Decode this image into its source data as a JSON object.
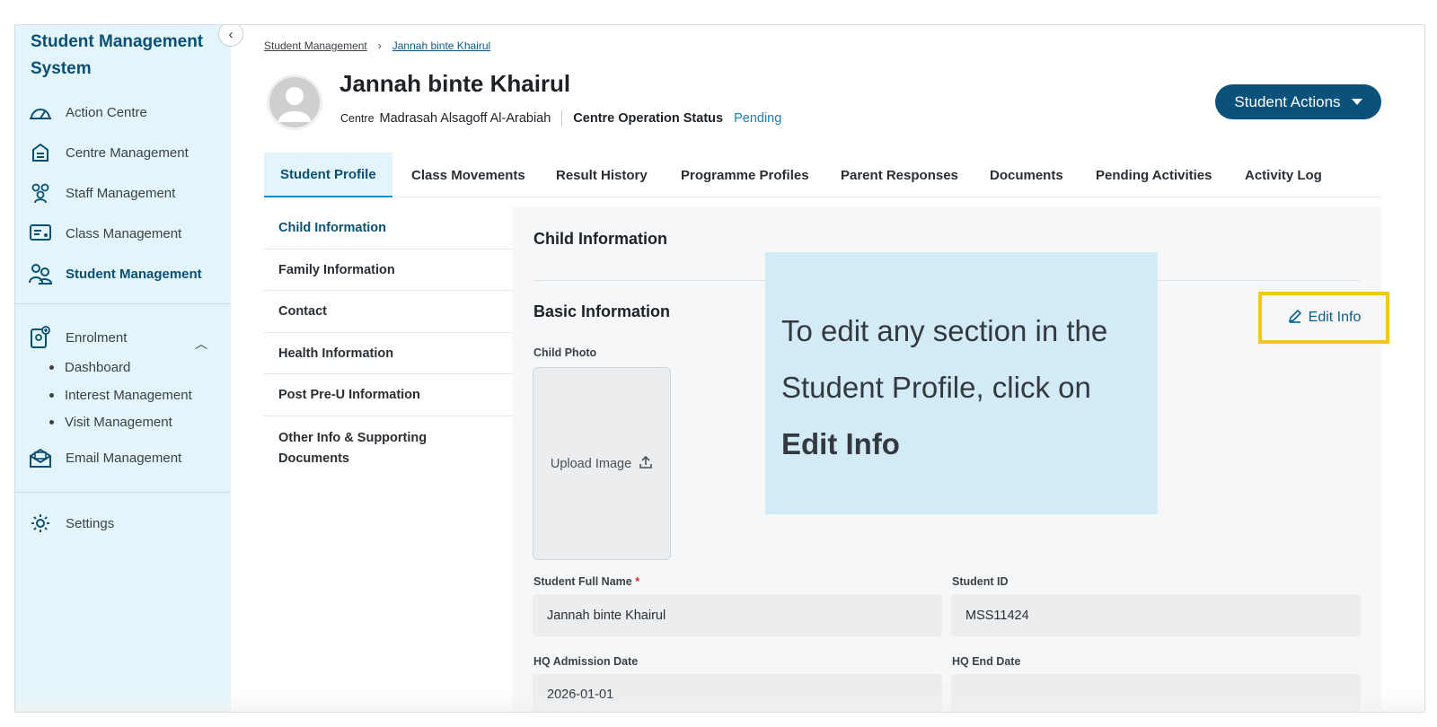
{
  "app": {
    "title": "Student Management System"
  },
  "sidebar": {
    "items": [
      {
        "label": "Action Centre",
        "icon": "dashboard-gauge-icon"
      },
      {
        "label": "Centre Management",
        "icon": "building-icon"
      },
      {
        "label": "Staff Management",
        "icon": "staff-group-icon"
      },
      {
        "label": "Class Management",
        "icon": "classroom-board-icon"
      },
      {
        "label": "Student Management",
        "icon": "students-icon",
        "active": true
      }
    ],
    "enrolment": {
      "label": "Enrolment",
      "icon": "enrolment-form-icon",
      "expanded": true,
      "children": [
        "Dashboard",
        "Interest Management",
        "Visit Management"
      ]
    },
    "email": {
      "label": "Email Management",
      "icon": "email-envelope-icon"
    },
    "settings": {
      "label": "Settings",
      "icon": "gear-icon"
    }
  },
  "breadcrumb": {
    "root": "Student Management",
    "current": "Jannah binte Khairul"
  },
  "student": {
    "name": "Jannah binte Khairul",
    "centre_label": "Centre",
    "centre_value": "Madrasah Alsagoff Al-Arabiah",
    "status_label": "Centre Operation Status",
    "status_value": "Pending"
  },
  "actions_button": {
    "label": "Student Actions"
  },
  "tabs": [
    {
      "label": "Student Profile",
      "active": true
    },
    {
      "label": "Class Movements"
    },
    {
      "label": "Result History"
    },
    {
      "label": "Programme Profiles"
    },
    {
      "label": "Parent Responses"
    },
    {
      "label": "Documents"
    },
    {
      "label": "Pending Activities"
    },
    {
      "label": "Activity Log"
    }
  ],
  "subnav": [
    {
      "label": "Child Information",
      "active": true
    },
    {
      "label": "Family Information"
    },
    {
      "label": "Contact"
    },
    {
      "label": "Health Information"
    },
    {
      "label": "Post Pre-U Information"
    },
    {
      "label": "Other Info & Supporting Documents"
    }
  ],
  "content": {
    "section_title": "Child Information",
    "basic_title": "Basic Information",
    "child_photo_label": "Child Photo",
    "upload_label": "Upload Image",
    "edit_info_label": "Edit Info",
    "fields": {
      "full_name_label": "Student Full Name",
      "required_mark": "*",
      "full_name_value": "Jannah binte Khairul",
      "student_id_label": "Student ID",
      "student_id_value": "MSS11424",
      "admission_label": "HQ Admission Date",
      "admission_value": "2026-01-01",
      "end_label": "HQ End Date",
      "end_value": ""
    }
  },
  "callout": {
    "text": "To edit any section in the Student Profile, click on",
    "emphasis": "Edit Info"
  },
  "colors": {
    "sidebar_bg": "#e3f5fa",
    "brand": "#0a527a",
    "link": "#0a5e8a",
    "status_pending": "#1a7fb0",
    "highlight": "#f5c518",
    "callout_bg": "#d3ebf7"
  }
}
